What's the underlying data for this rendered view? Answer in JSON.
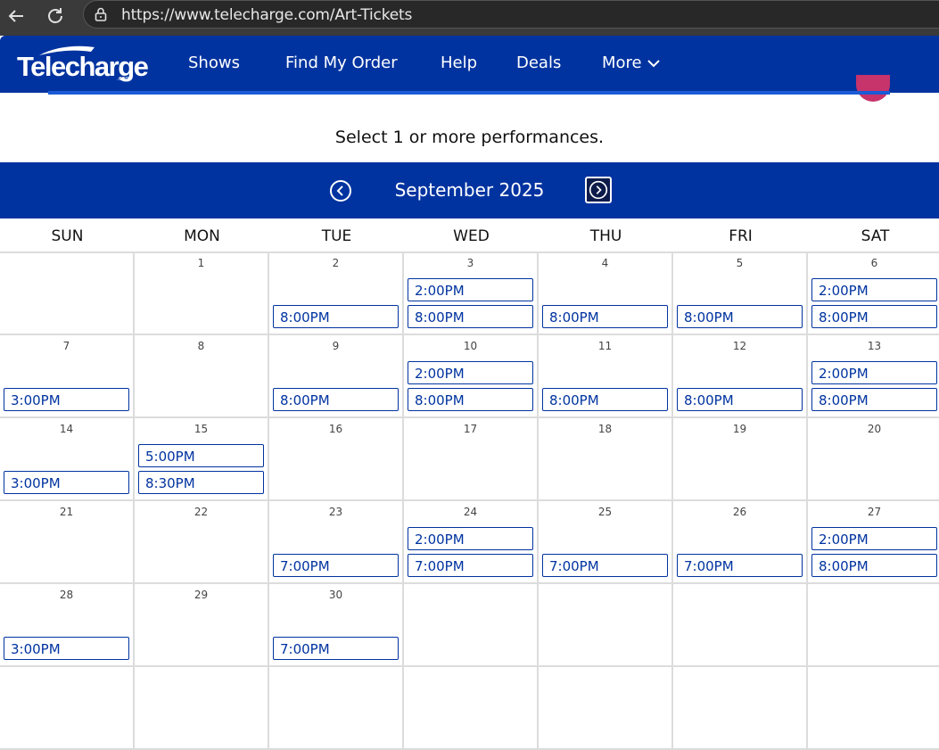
{
  "browser": {
    "url": "https://www.telecharge.com/Art-Tickets"
  },
  "header": {
    "logo_text": "Telecharge",
    "logo_sub": ".com",
    "nav": [
      {
        "label": "Shows"
      },
      {
        "label": "Find My Order"
      },
      {
        "label": "Help"
      },
      {
        "label": "Deals"
      },
      {
        "label": "More"
      }
    ]
  },
  "instruction": "Select 1 or more performances.",
  "calendar": {
    "month": "September 2025",
    "weekdays": [
      "SUN",
      "MON",
      "TUE",
      "WED",
      "THU",
      "FRI",
      "SAT"
    ],
    "weeks": [
      [
        {
          "day": "",
          "times": []
        },
        {
          "day": "1",
          "times": []
        },
        {
          "day": "2",
          "times": [
            "8:00PM"
          ]
        },
        {
          "day": "3",
          "times": [
            "2:00PM",
            "8:00PM"
          ]
        },
        {
          "day": "4",
          "times": [
            "8:00PM"
          ]
        },
        {
          "day": "5",
          "times": [
            "8:00PM"
          ]
        },
        {
          "day": "6",
          "times": [
            "2:00PM",
            "8:00PM"
          ]
        }
      ],
      [
        {
          "day": "7",
          "times": [
            "3:00PM"
          ]
        },
        {
          "day": "8",
          "times": []
        },
        {
          "day": "9",
          "times": [
            "8:00PM"
          ]
        },
        {
          "day": "10",
          "times": [
            "2:00PM",
            "8:00PM"
          ]
        },
        {
          "day": "11",
          "times": [
            "8:00PM"
          ]
        },
        {
          "day": "12",
          "times": [
            "8:00PM"
          ]
        },
        {
          "day": "13",
          "times": [
            "2:00PM",
            "8:00PM"
          ]
        }
      ],
      [
        {
          "day": "14",
          "times": [
            "3:00PM"
          ]
        },
        {
          "day": "15",
          "times": [
            "5:00PM",
            "8:30PM"
          ]
        },
        {
          "day": "16",
          "times": []
        },
        {
          "day": "17",
          "times": []
        },
        {
          "day": "18",
          "times": []
        },
        {
          "day": "19",
          "times": []
        },
        {
          "day": "20",
          "times": []
        }
      ],
      [
        {
          "day": "21",
          "times": []
        },
        {
          "day": "22",
          "times": []
        },
        {
          "day": "23",
          "times": [
            "7:00PM"
          ]
        },
        {
          "day": "24",
          "times": [
            "2:00PM",
            "7:00PM"
          ]
        },
        {
          "day": "25",
          "times": [
            "7:00PM"
          ]
        },
        {
          "day": "26",
          "times": [
            "7:00PM"
          ]
        },
        {
          "day": "27",
          "times": [
            "2:00PM",
            "8:00PM"
          ]
        }
      ],
      [
        {
          "day": "28",
          "times": [
            "3:00PM"
          ]
        },
        {
          "day": "29",
          "times": []
        },
        {
          "day": "30",
          "times": [
            "7:00PM"
          ]
        },
        {
          "day": "",
          "times": []
        },
        {
          "day": "",
          "times": []
        },
        {
          "day": "",
          "times": []
        },
        {
          "day": "",
          "times": []
        }
      ],
      [
        {
          "day": "",
          "times": []
        },
        {
          "day": "",
          "times": []
        },
        {
          "day": "",
          "times": []
        },
        {
          "day": "",
          "times": []
        },
        {
          "day": "",
          "times": []
        },
        {
          "day": "",
          "times": []
        },
        {
          "day": "",
          "times": []
        }
      ]
    ]
  },
  "colors": {
    "brand_blue": "#0033a0",
    "accent_pink": "#c7336b"
  },
  "icons": {
    "back": "back-arrow-icon",
    "reload": "reload-icon",
    "lock": "lock-icon",
    "prev": "chevron-left-circle-icon",
    "next": "chevron-right-circle-icon",
    "more": "chevron-down-icon"
  }
}
